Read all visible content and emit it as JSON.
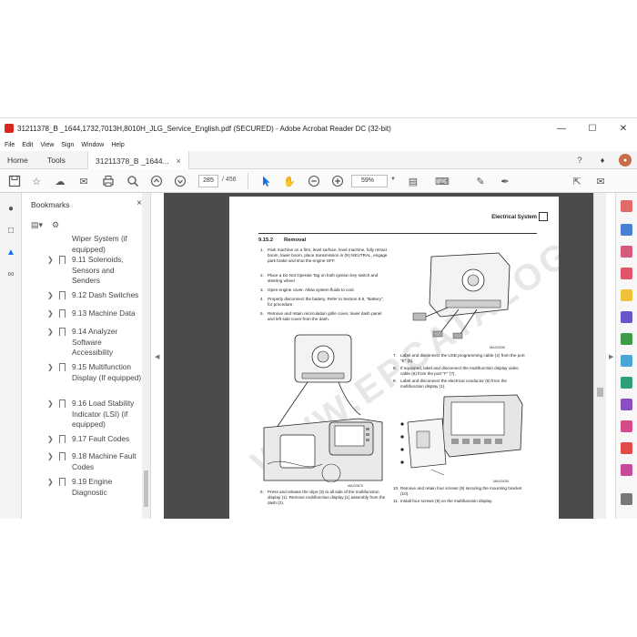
{
  "window": {
    "title": "31211378_B _1644,1732,7013H,8010H_JLG_Service_English.pdf (SECURED) - Adobe Acrobat Reader DC (32-bit)",
    "minimize": "—",
    "maximize": "☐",
    "close": "✕"
  },
  "menu": [
    "File",
    "Edit",
    "View",
    "Sign",
    "Window",
    "Help"
  ],
  "tabs": {
    "home": "Home",
    "tools": "Tools",
    "document": "31211378_B _1644...",
    "document_close": "×"
  },
  "toolbar": {
    "current_page": "285",
    "total_pages": "/ 456",
    "zoom": "59%"
  },
  "bookmarks": {
    "title": "Bookmarks",
    "close": "×",
    "items": [
      {
        "label": "Wiper System (if equipped)",
        "has_children": false
      },
      {
        "label": "9.11 Solenoids, Sensors and Senders",
        "has_children": true
      },
      {
        "label": "9.12 Dash Switches",
        "has_children": true
      },
      {
        "label": "9.13 Machine Data",
        "has_children": true
      },
      {
        "label": "9.14 Analyzer Software Accessibility",
        "has_children": true
      },
      {
        "label": "9.15 Multifunction Display (If equipped)",
        "has_children": true
      },
      {
        "label": "9.16 Load Stability Indicator (LSI) (if equipped)",
        "has_children": true
      },
      {
        "label": "9.17 Fault Codes",
        "has_children": true
      },
      {
        "label": "9.18 Machine Fault Codes",
        "has_children": true
      },
      {
        "label": "9.19 Engine Diagnostic",
        "has_children": true
      }
    ]
  },
  "page": {
    "header": "Electrical System",
    "section_number": "9.15.2",
    "section_title": "Removal",
    "steps_left": [
      {
        "n": "1.",
        "text": "Park machine on a firm, level surface, level machine, fully retract boom, lower boom, place transmission in (N) NEUTRAL, engage park brake and shut the engine OFF."
      },
      {
        "n": "2.",
        "text": "Place a Do Not Operate Tag on both ignition key switch and steering wheel."
      },
      {
        "n": "3.",
        "text": "Open engine cover. Allow system fluids to cool."
      },
      {
        "n": "4.",
        "text": "Properly disconnect the battery. Refer to Section 9.6, \"Battery\", for procedure."
      },
      {
        "n": "5.",
        "text": "Remove and retain recirculation grille cover, lower dash panel and left side cover from the dash."
      },
      {
        "n": "6.",
        "text": "Press and release the clips (3) to all side of the multifunction display (1). Remove multifunction display (1) assembly from the dash (2)."
      }
    ],
    "steps_right": [
      {
        "n": "7.",
        "text": "Label and disconnect the USB programming cable (4) from the port \"E\" (5)."
      },
      {
        "n": "8.",
        "text": "If equipped, label and disconnect the multifunction display video cable (6) from the port \"F\" (7)."
      },
      {
        "n": "9.",
        "text": "Label and disconnect the electrical conductor (8) from the multifunction display (1)."
      },
      {
        "n": "10.",
        "text": "Remove and retain four screws (9) securing the mounting bracket (10)."
      },
      {
        "n": "11.",
        "text": "Install four screws (9) on the multifunction display."
      }
    ],
    "figure_ids": [
      "MAG0030",
      "MAG0670",
      "MAG0030"
    ],
    "watermark": "WWW.EPCATALOGS.COM"
  },
  "colors": {
    "acrobat_red": "#d9251d",
    "doc_background": "#4b4b4b"
  }
}
